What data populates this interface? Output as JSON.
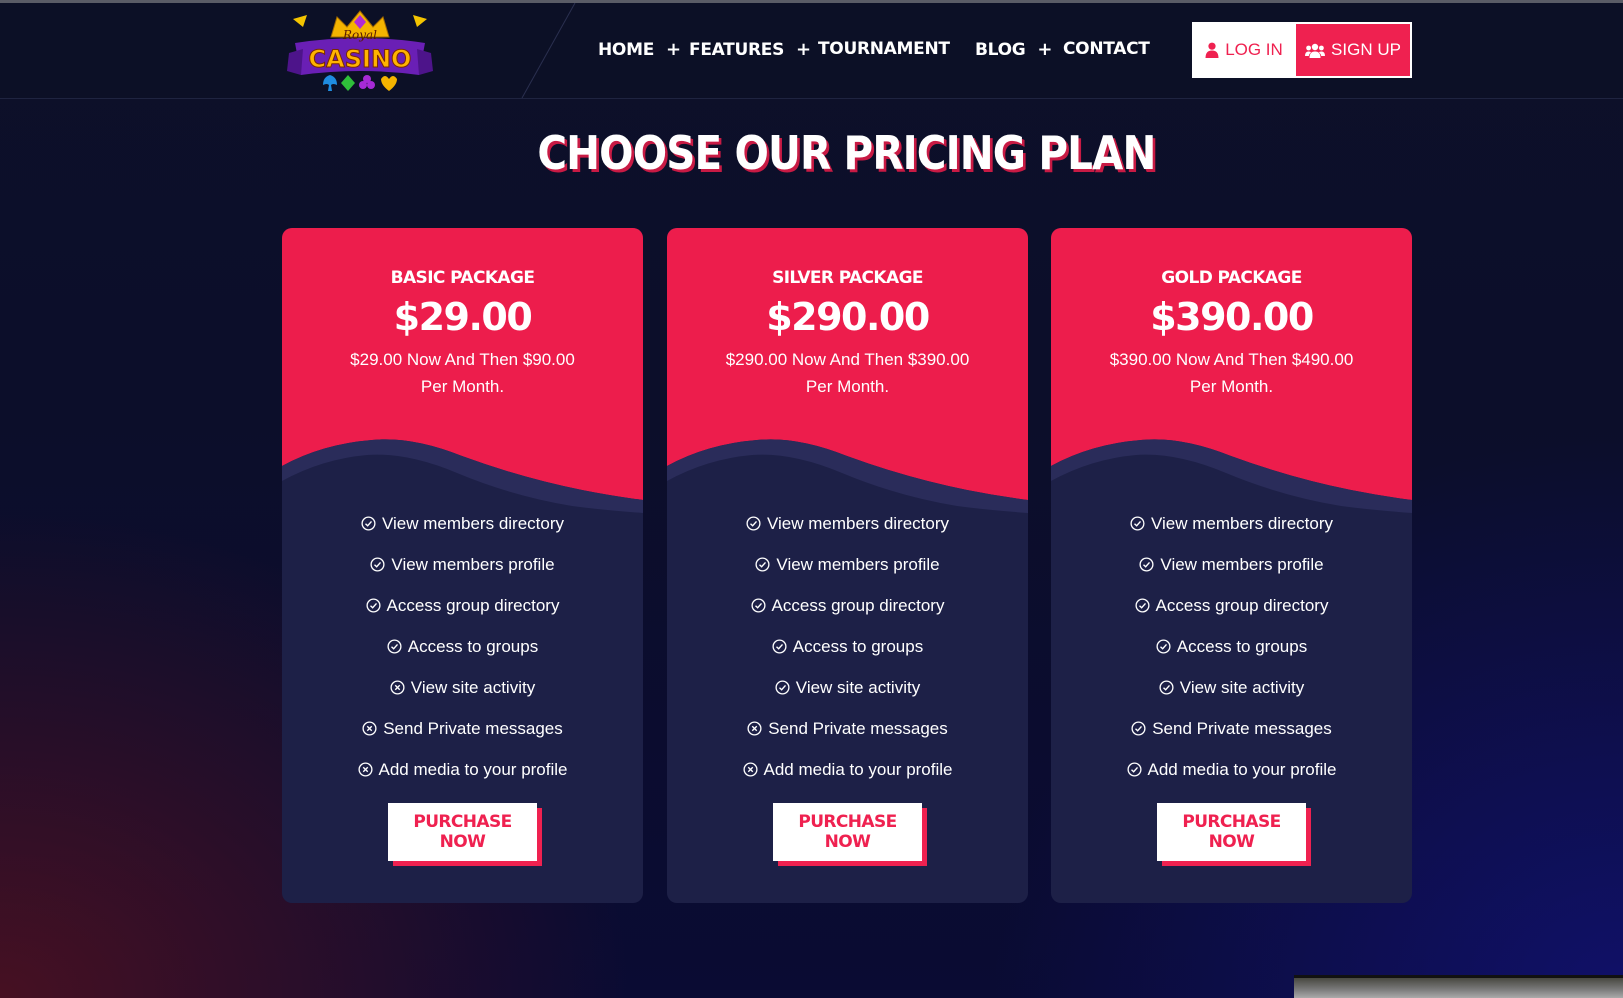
{
  "header": {
    "logo": {
      "top_text": "Royal",
      "main_text": "CASINO"
    },
    "nav": [
      {
        "label": "HOME",
        "has_plus": true
      },
      {
        "label": "FEATURES",
        "has_plus": true
      },
      {
        "label": "TOURNAMENT",
        "has_plus": false
      },
      {
        "label": "BLOG",
        "has_plus": true
      },
      {
        "label": "CONTACT",
        "has_plus": false
      }
    ],
    "login_label": "LOG IN",
    "signup_label": "SIGN UP",
    "plus_symbol": "+"
  },
  "pricing": {
    "title": "CHOOSE OUR PRICING PLAN",
    "feature_labels": [
      "View members directory",
      "View members profile",
      "Access group directory",
      "Access to groups",
      "View site activity",
      "Send Private messages",
      "Add media to your profile"
    ],
    "plans": [
      {
        "name": "BASIC PACKAGE",
        "price": "$29.00",
        "description": "$29.00 Now And Then $90.00 Per Month.",
        "features_included": [
          true,
          true,
          true,
          true,
          false,
          false,
          false
        ],
        "button_label": "PURCHASE NOW"
      },
      {
        "name": "SILVER PACKAGE",
        "price": "$290.00",
        "description": "$290.00 Now And Then $390.00 Per Month.",
        "features_included": [
          true,
          true,
          true,
          true,
          true,
          false,
          false
        ],
        "button_label": "PURCHASE NOW"
      },
      {
        "name": "GOLD PACKAGE",
        "price": "$390.00",
        "description": "$390.00 Now And Then $490.00 Per Month.",
        "features_included": [
          true,
          true,
          true,
          true,
          true,
          true,
          true
        ],
        "button_label": "PURCHASE NOW"
      }
    ]
  },
  "icons": {
    "included": "check-circle-icon",
    "excluded": "x-circle-icon",
    "login": "user-icon",
    "signup": "users-icon"
  },
  "colors": {
    "accent": "#ef2150",
    "card_bg": "#1d2047",
    "header_bg": "#0c1026"
  }
}
